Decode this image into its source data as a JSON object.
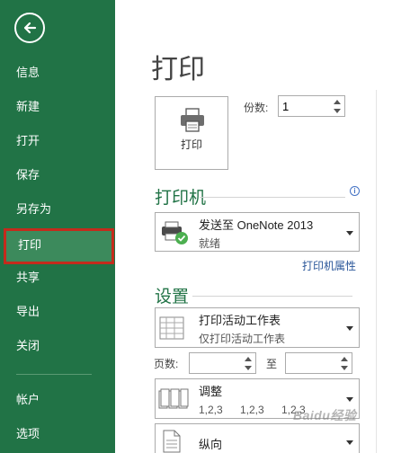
{
  "sidebar": {
    "back_label": "返回",
    "items": [
      {
        "label": "信息"
      },
      {
        "label": "新建"
      },
      {
        "label": "打开"
      },
      {
        "label": "保存"
      },
      {
        "label": "另存为"
      },
      {
        "label": "打印",
        "active": true
      },
      {
        "label": "共享"
      },
      {
        "label": "导出"
      },
      {
        "label": "关闭"
      },
      {
        "label": "帐户"
      },
      {
        "label": "选项"
      }
    ],
    "bg_color": "#217346",
    "active_border_color": "#c42b1c"
  },
  "main": {
    "title": "打印",
    "print_button_label": "打印",
    "copies_label": "份数:",
    "copies_value": "1",
    "printer_section": {
      "title": "打印机",
      "selected_name": "发送至 OneNote 2013",
      "status": "就绪",
      "properties_link": "打印机属性"
    },
    "settings_section": {
      "title": "设置",
      "print_what": {
        "main": "打印活动工作表",
        "sub": "仅打印活动工作表"
      },
      "pages_label": "页数:",
      "to_label": "至",
      "pages_from": "",
      "pages_to": "",
      "collate": {
        "main": "调整",
        "values": [
          "1,2,3",
          "1,2,3",
          "1,2,3"
        ]
      },
      "orientation": {
        "main": "纵向"
      }
    },
    "accent_color": "#217346"
  },
  "watermark": "Baidu经验"
}
